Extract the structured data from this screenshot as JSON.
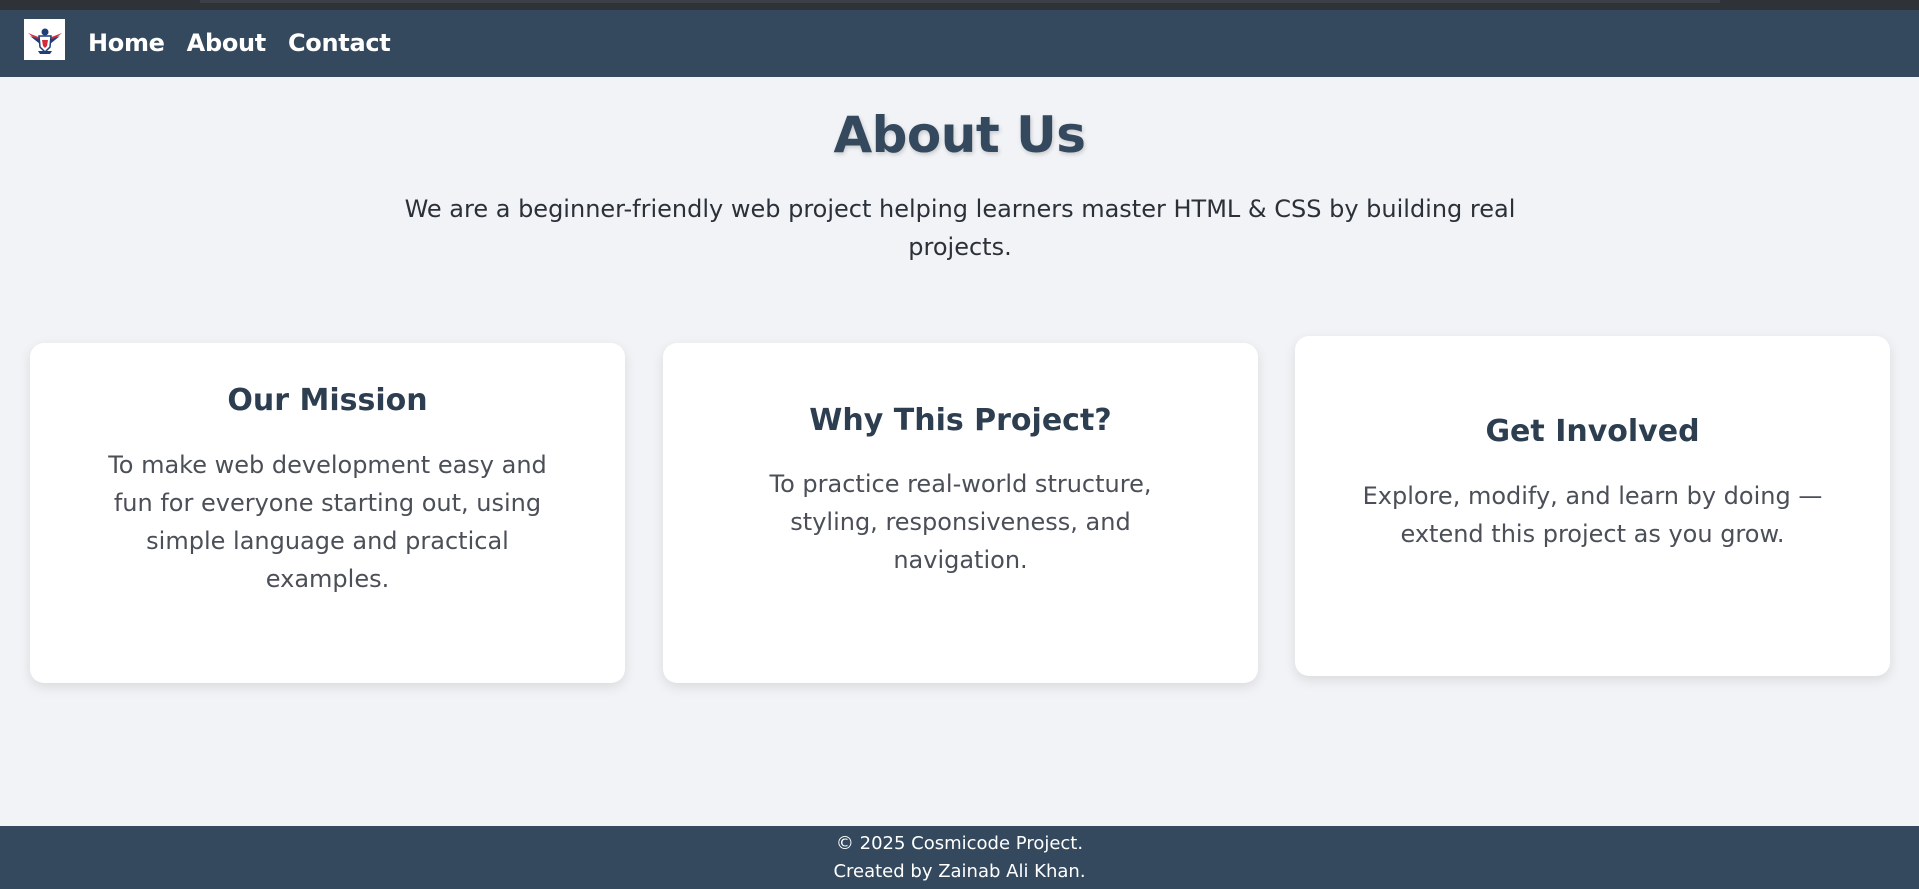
{
  "nav": {
    "logo_icon": "eagle-shield-logo-icon",
    "items": [
      {
        "label": "Home"
      },
      {
        "label": "About"
      },
      {
        "label": "Contact"
      }
    ]
  },
  "main": {
    "title": "About Us",
    "intro": "We are a beginner-friendly web project helping learners master HTML & CSS by building real projects.",
    "cards": [
      {
        "title": "Our Mission",
        "text": "To make web development easy and fun for everyone starting out, using simple language and practical examples."
      },
      {
        "title": "Why This Project?",
        "text": "To practice real-world structure, styling, responsiveness, and navigation."
      },
      {
        "title": "Get Involved",
        "text": "Explore, modify, and learn by doing — extend this project as you grow."
      }
    ]
  },
  "footer": {
    "line1": "© 2025 Cosmicode Project.",
    "line2": "Created by Zainab Ali Khan."
  },
  "colors": {
    "header_bg": "#34495e",
    "page_bg": "#f1f3f6",
    "card_bg": "#ffffff",
    "title_color": "#34495e"
  }
}
